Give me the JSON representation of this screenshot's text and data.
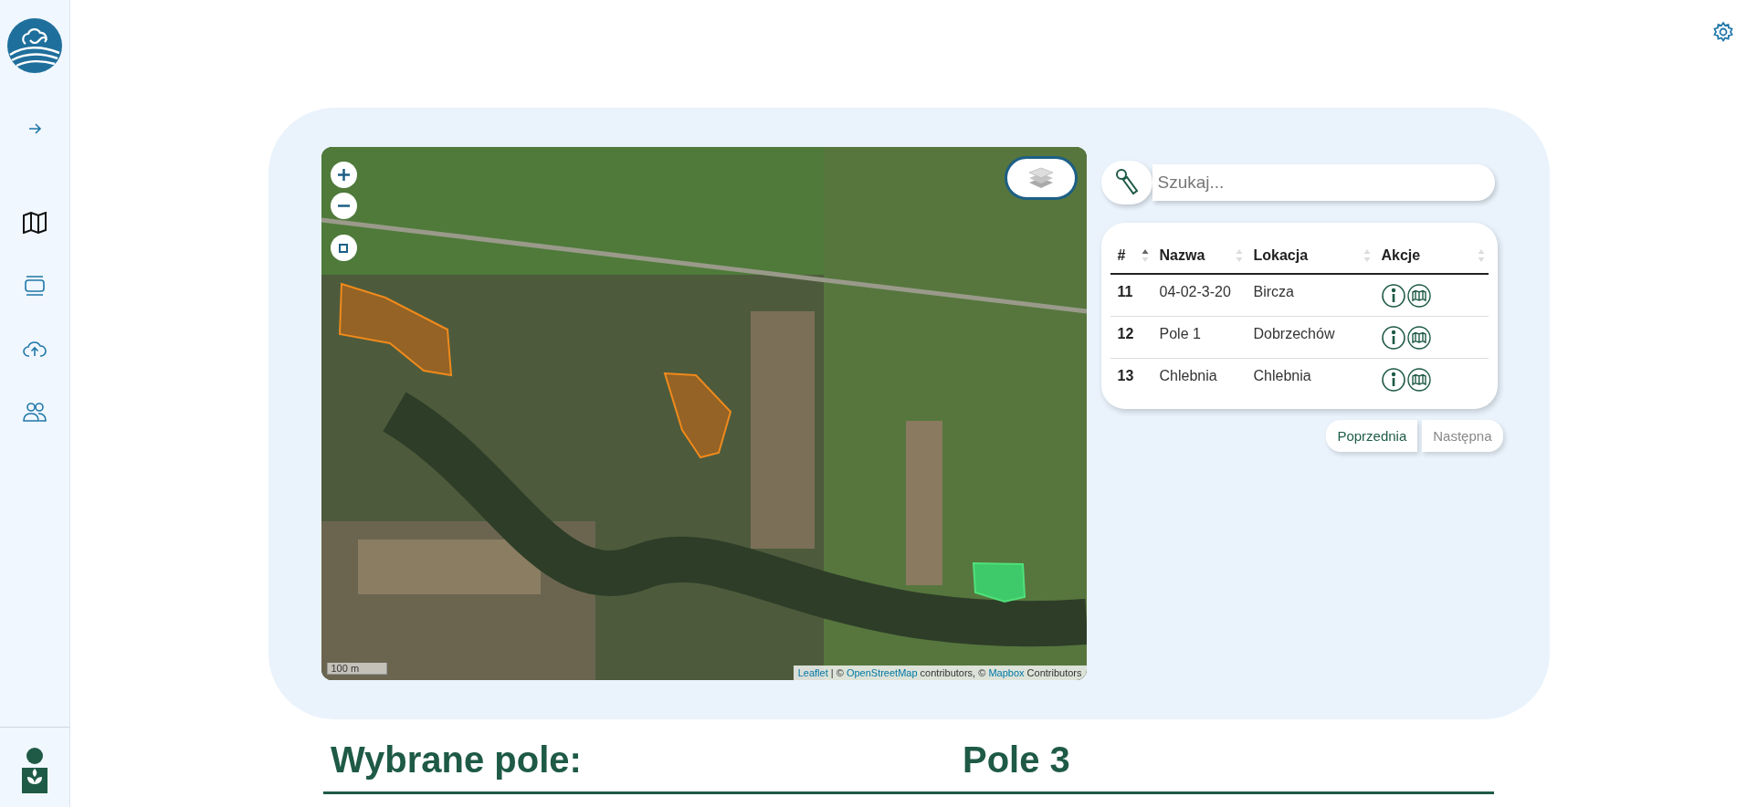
{
  "sidebar": {
    "items": [
      {
        "kind": "expand",
        "selected": false
      },
      {
        "kind": "map",
        "selected": true
      },
      {
        "kind": "list",
        "selected": false
      },
      {
        "kind": "upload",
        "selected": false
      },
      {
        "kind": "users",
        "selected": false
      }
    ]
  },
  "map": {
    "scale": "100 m",
    "attribution": {
      "leaflet": "Leaflet",
      "sep1": "| ©",
      "osm": "OpenStreetMap",
      "mid": "contributors, ©",
      "mapbox": "Mapbox",
      "end": "Contributors"
    }
  },
  "search": {
    "placeholder": "Szukaj..."
  },
  "table": {
    "columns": [
      {
        "label": "#",
        "sorted_asc": true
      },
      {
        "label": "Nazwa",
        "sorted_asc": false
      },
      {
        "label": "Lokacja",
        "sorted_asc": false
      },
      {
        "label": "Akcje",
        "sorted_asc": false
      }
    ],
    "rows": [
      {
        "id": "11",
        "name": "04-02-3-20",
        "location": "Bircza"
      },
      {
        "id": "12",
        "name": "Pole 1",
        "location": "Dobrzechów"
      },
      {
        "id": "13",
        "name": "Chlebnia",
        "location": "Chlebnia"
      }
    ]
  },
  "pagination": [
    {
      "label": "Poprzednia",
      "disabled": false
    },
    {
      "label": "Następna",
      "disabled": true
    }
  ],
  "selected_field": {
    "label": "Wybrane pole:",
    "value": "Pole 3"
  }
}
